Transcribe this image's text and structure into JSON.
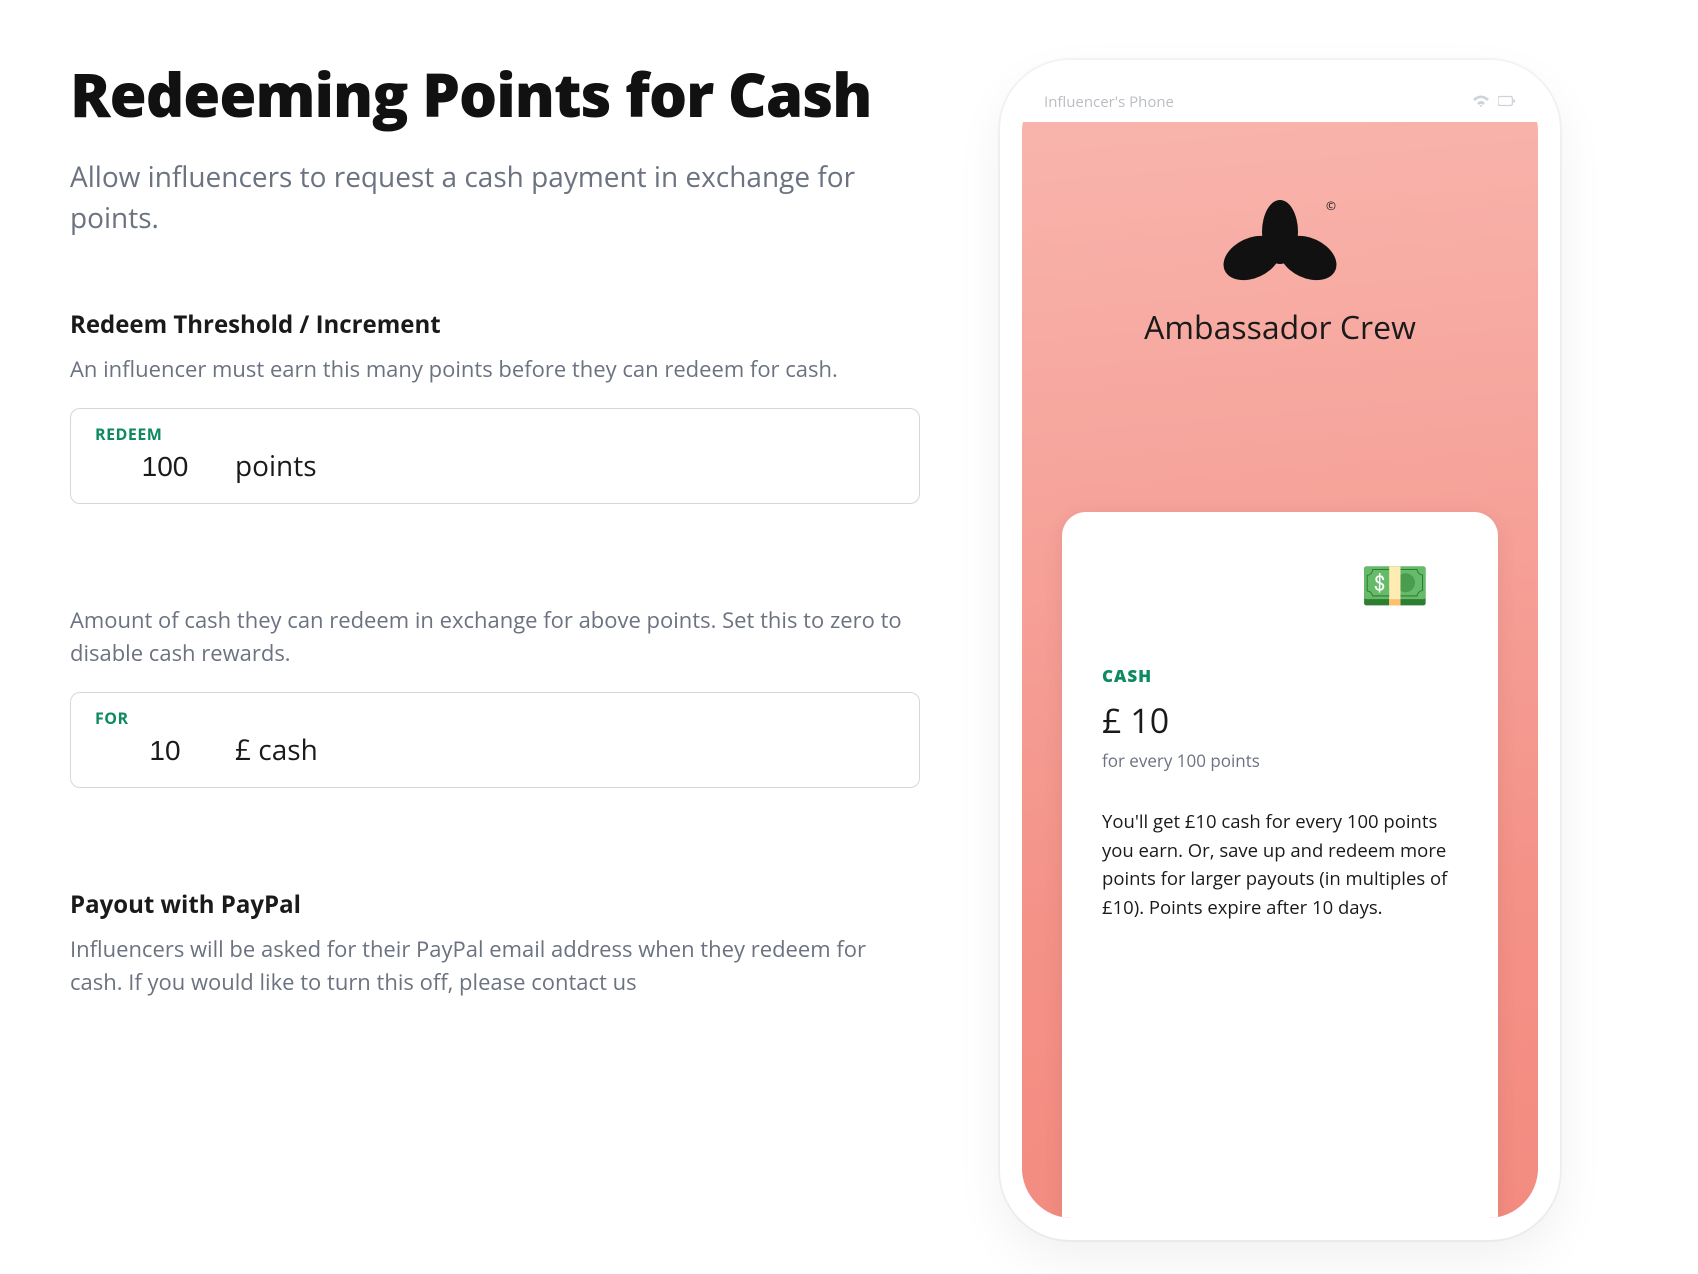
{
  "main": {
    "title": "Redeeming Points for Cash",
    "subtitle": "Allow influencers to request a cash payment in exchange for points.",
    "section1": {
      "heading": "Redeem Threshold / Increment",
      "desc": "An influencer must earn this many points before they can redeem for cash.",
      "field_label": "REDEEM",
      "value": "100",
      "unit": "points"
    },
    "section2": {
      "desc": "Amount of cash they can redeem in exchange for above points. Set this to zero to disable cash rewards.",
      "field_label": "FOR",
      "value": "10",
      "unit": "£ cash"
    },
    "section3": {
      "heading": "Payout with PayPal",
      "desc": "Influencers will be asked for their PayPal email address when they redeem for cash. If you would like to turn this off, please contact us"
    }
  },
  "phone": {
    "status_title": "Influencer's Phone",
    "brand": "Ambassador Crew",
    "card": {
      "label": "CASH",
      "amount": "£ 10",
      "sub": "for every 100 points",
      "desc": "You'll get £10 cash for every 100 points you earn. Or, save up and redeem more points for larger payouts (in multiples of £10). Points expire after 10 days.",
      "emoji": "💵"
    }
  }
}
